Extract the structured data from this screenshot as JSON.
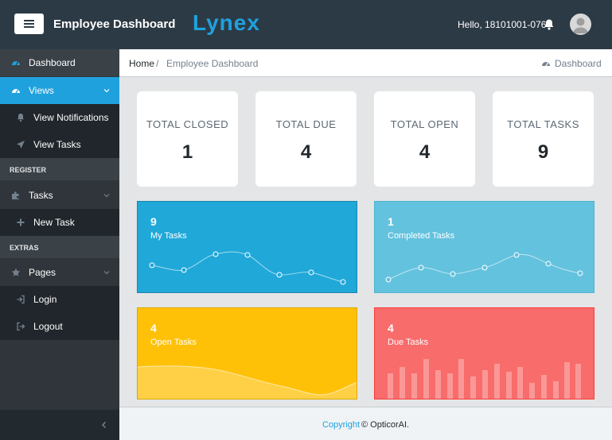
{
  "header": {
    "title": "Employee Dashboard",
    "brand": "Lynex",
    "greeting": "Hello, 18101001-076",
    "brand_color": "#1fa1de",
    "bg_color": "#2c3a45"
  },
  "sidebar": {
    "items": [
      {
        "label": "Dashboard",
        "icon": "speedometer-icon"
      },
      {
        "label": "Views",
        "icon": "speedometer-icon",
        "active": true
      },
      {
        "label": "View Notifications",
        "icon": "bell-icon"
      },
      {
        "label": "View Tasks",
        "icon": "send-icon"
      },
      {
        "label": "Tasks",
        "icon": "puzzle-icon"
      },
      {
        "label": "New Task",
        "icon": "plus-icon"
      },
      {
        "label": "Pages",
        "icon": "star-icon"
      },
      {
        "label": "Login",
        "icon": "login-icon"
      },
      {
        "label": "Logout",
        "icon": "logout-icon"
      }
    ],
    "sections": [
      "REGISTER",
      "EXTRAS"
    ]
  },
  "breadcrumb": {
    "home": "Home",
    "separator": "/",
    "current": "Employee Dashboard",
    "right_label": "Dashboard"
  },
  "stats": [
    {
      "title": "TOTAL CLOSED",
      "value": "1"
    },
    {
      "title": "TOTAL DUE",
      "value": "4"
    },
    {
      "title": "TOTAL OPEN",
      "value": "4"
    },
    {
      "title": "TOTAL TASKS",
      "value": "9"
    }
  ],
  "cards": [
    {
      "value": "9",
      "caption": "My Tasks",
      "color": "#20a8d8"
    },
    {
      "value": "1",
      "caption": "Completed Tasks",
      "color": "#63c2de"
    },
    {
      "value": "4",
      "caption": "Open Tasks",
      "color": "#ffc107"
    },
    {
      "value": "4",
      "caption": "Due Tasks",
      "color": "#f86c6b"
    }
  ],
  "footer": {
    "link": "Copyright",
    "text": "© OpticorAI."
  }
}
